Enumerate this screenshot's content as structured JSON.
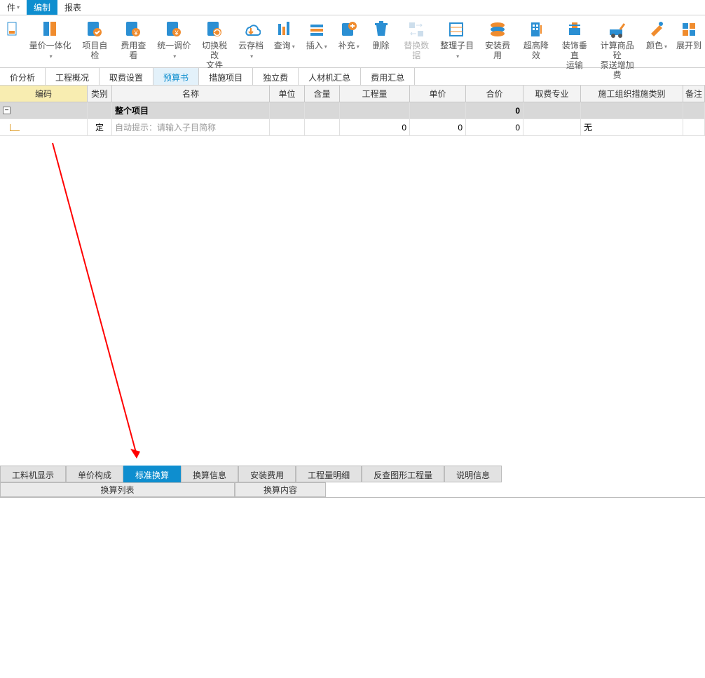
{
  "topbar": {
    "file": "件",
    "edit": "编制",
    "report": "报表"
  },
  "ribbon": {
    "yihua": "量价一体化",
    "zijian": "项目自检",
    "feiyong": "费用查看",
    "tongyi": "统一调价",
    "shuigai": "切换税改\n文件",
    "yuncun": "云存档",
    "chaxun": "查询",
    "charu": "插入",
    "buchong": "补充",
    "shanchu": "删除",
    "tihuan": "替换数据",
    "zhengli": "整理子目",
    "anzhuang": "安装费用",
    "chaogao": "超高降效",
    "zhuangshi": "装饰垂直\n运输",
    "jisuan": "计算商品砼\n泵送增加费",
    "yanse": "颜色",
    "zhankai": "展开到"
  },
  "subtabs": {
    "fenxi": "价分析",
    "gaikuang": "工程概况",
    "qufei": "取费设置",
    "yusuan": "预算书",
    "cuoshi": "措施项目",
    "dulifei": "独立费",
    "rencai": "人材机汇总",
    "fyhz": "费用汇总"
  },
  "grid": {
    "headers": {
      "code": "编码",
      "type": "类别",
      "name": "名称",
      "unit": "单位",
      "qty": "含量",
      "gcl": "工程量",
      "price": "单价",
      "total": "合价",
      "major": "取费专业",
      "cat": "施工组织措施类别",
      "note": "备注"
    },
    "row_project": {
      "name": "整个项目",
      "total": "0"
    },
    "row_input": {
      "type": "定",
      "name_placeholder": "自动提示：请输入子目简称",
      "gcl": "0",
      "price": "0",
      "total": "0",
      "cat": "无"
    }
  },
  "bottom_tabs": {
    "gongliao": "工料机显示",
    "danjia": "单价构成",
    "biaozhun": "标准换算",
    "huansuan": "换算信息",
    "anzhuang": "安装费用",
    "mingxi": "工程量明细",
    "fancha": "反查图形工程量",
    "shuoming": "说明信息"
  },
  "bottom_sub": {
    "list": "换算列表",
    "content": "换算内容"
  }
}
